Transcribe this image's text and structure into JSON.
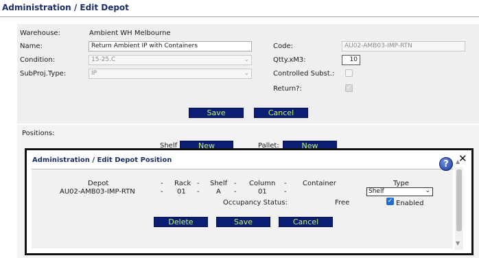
{
  "page": {
    "title": "Administration / Edit Depot"
  },
  "form": {
    "warehouse_label": "Warehouse:",
    "warehouse_value": "Ambient WH Melbourne",
    "name_label": "Name:",
    "name_value": "Return Ambient IP with Containers",
    "code_label": "Code:",
    "code_value": "AU02-AMB03-IMP-RTN",
    "condition_label": "Condition:",
    "condition_value": "15-25.C",
    "qtty_label": "Qtty.xM3:",
    "qtty_value": "10",
    "subproj_label": "SubProj.Type:",
    "subproj_value": "IP",
    "controlled_label": "Controlled Subst.:",
    "controlled_checked": false,
    "return_label": "Return?:",
    "return_checked": true,
    "save_label": "Save",
    "cancel_label": "Cancel"
  },
  "positions": {
    "label": "Positions:",
    "shelf_label": "Shelf",
    "shelf_new_label": "New",
    "pallet_label": "Pallet:",
    "pallet_new_label": "New"
  },
  "modal": {
    "title": "Administration / Edit Depot Position",
    "help_icon_glyph": "?",
    "close_icon_glyph": "✕",
    "headers": {
      "depot": "Depot",
      "rack": "Rack",
      "shelf": "Shelf",
      "column": "Column",
      "container": "Container",
      "type": "Type"
    },
    "separator": "-",
    "values": {
      "depot": "AU02-AMB03-IMP-RTN",
      "rack": "01",
      "shelf": "A",
      "column": "01"
    },
    "type_selected": "Shelf",
    "occupancy_label": "Occupancy Status:",
    "occupancy_value": "Free",
    "enabled_label": "Enabled",
    "enabled_checked": true,
    "delete_label": "Delete",
    "save_label": "Save",
    "cancel_label": "Cancel"
  },
  "colors": {
    "button_bg": "#0c1e73",
    "button_text": "#c7f36d",
    "title_text": "#1c2f66"
  }
}
